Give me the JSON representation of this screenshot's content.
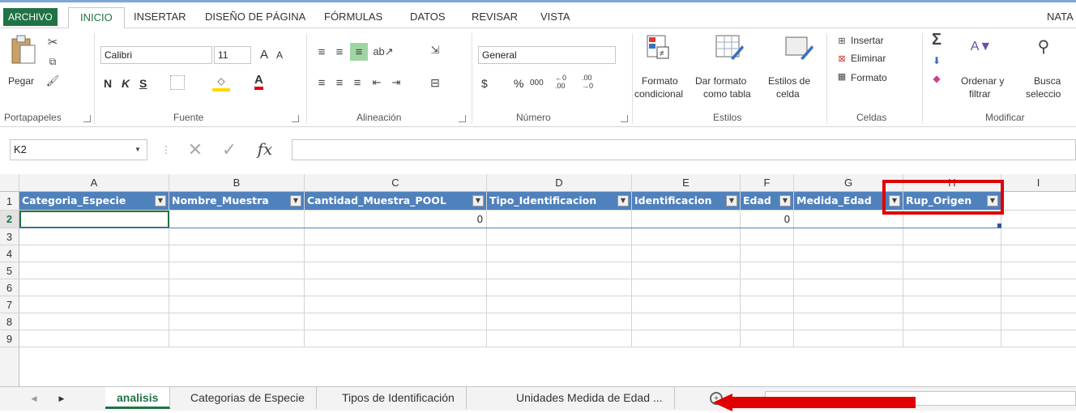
{
  "ribbon_tabs": {
    "archivo": "ARCHIVO",
    "inicio": "INICIO",
    "insertar": "INSERTAR",
    "diseno": "DISEÑO DE PÁGINA",
    "formulas": "FÓRMULAS",
    "datos": "DATOS",
    "revisar": "REVISAR",
    "vista": "VISTA",
    "user": "NATA"
  },
  "clipboard": {
    "paste": "Pegar",
    "label": "Portapapeles"
  },
  "font": {
    "name": "Calibri",
    "size": "11",
    "bold": "N",
    "italic": "K",
    "underline": "S",
    "label": "Fuente",
    "grow": "A",
    "shrink": "A",
    "color_a": "A"
  },
  "alignment": {
    "label": "Alineación"
  },
  "number": {
    "format": "General",
    "currency": "$",
    "percent": "%",
    "thousands": "000",
    "inc": "←0 .00",
    "dec": ".00 →0",
    "label": "Número"
  },
  "styles": {
    "cond1": "Formato",
    "cond2": "condicional",
    "table1": "Dar formato",
    "table2": "como tabla",
    "cell1": "Estilos de",
    "cell2": "celda",
    "label": "Estilos"
  },
  "cells": {
    "insert": "Insertar",
    "delete": "Eliminar",
    "format": "Formato",
    "label": "Celdas"
  },
  "editing": {
    "sort1": "Ordenar y",
    "sort2": "filtrar",
    "find1": "Busca",
    "find2": "seleccio",
    "label": "Modificar"
  },
  "formula_bar": {
    "namebox": "K2",
    "cancel": "✕",
    "enter": "✓",
    "fx": "fx",
    "value": ""
  },
  "columns": [
    "A",
    "B",
    "C",
    "D",
    "E",
    "F",
    "G",
    "H",
    "I"
  ],
  "rows": [
    "1",
    "2",
    "3",
    "4",
    "5",
    "6",
    "7",
    "8",
    "9"
  ],
  "headers": [
    "Categoria_Especie",
    "Nombre_Muestra",
    "Cantidad_Muestra_POOL",
    "Tipo_Identificacion",
    "Identificacion",
    "Edad",
    "Medida_Edad",
    "Rup_Origen"
  ],
  "row2": {
    "c": "0",
    "f": "0"
  },
  "sheets": [
    "analisis",
    "Categorias de Especie",
    "Tipos de Identificación",
    "Unidades Medida de Edad ..."
  ],
  "colors": {
    "accent": "#217346",
    "table_header": "#4f81bd",
    "highlight_box": "#e00000"
  }
}
